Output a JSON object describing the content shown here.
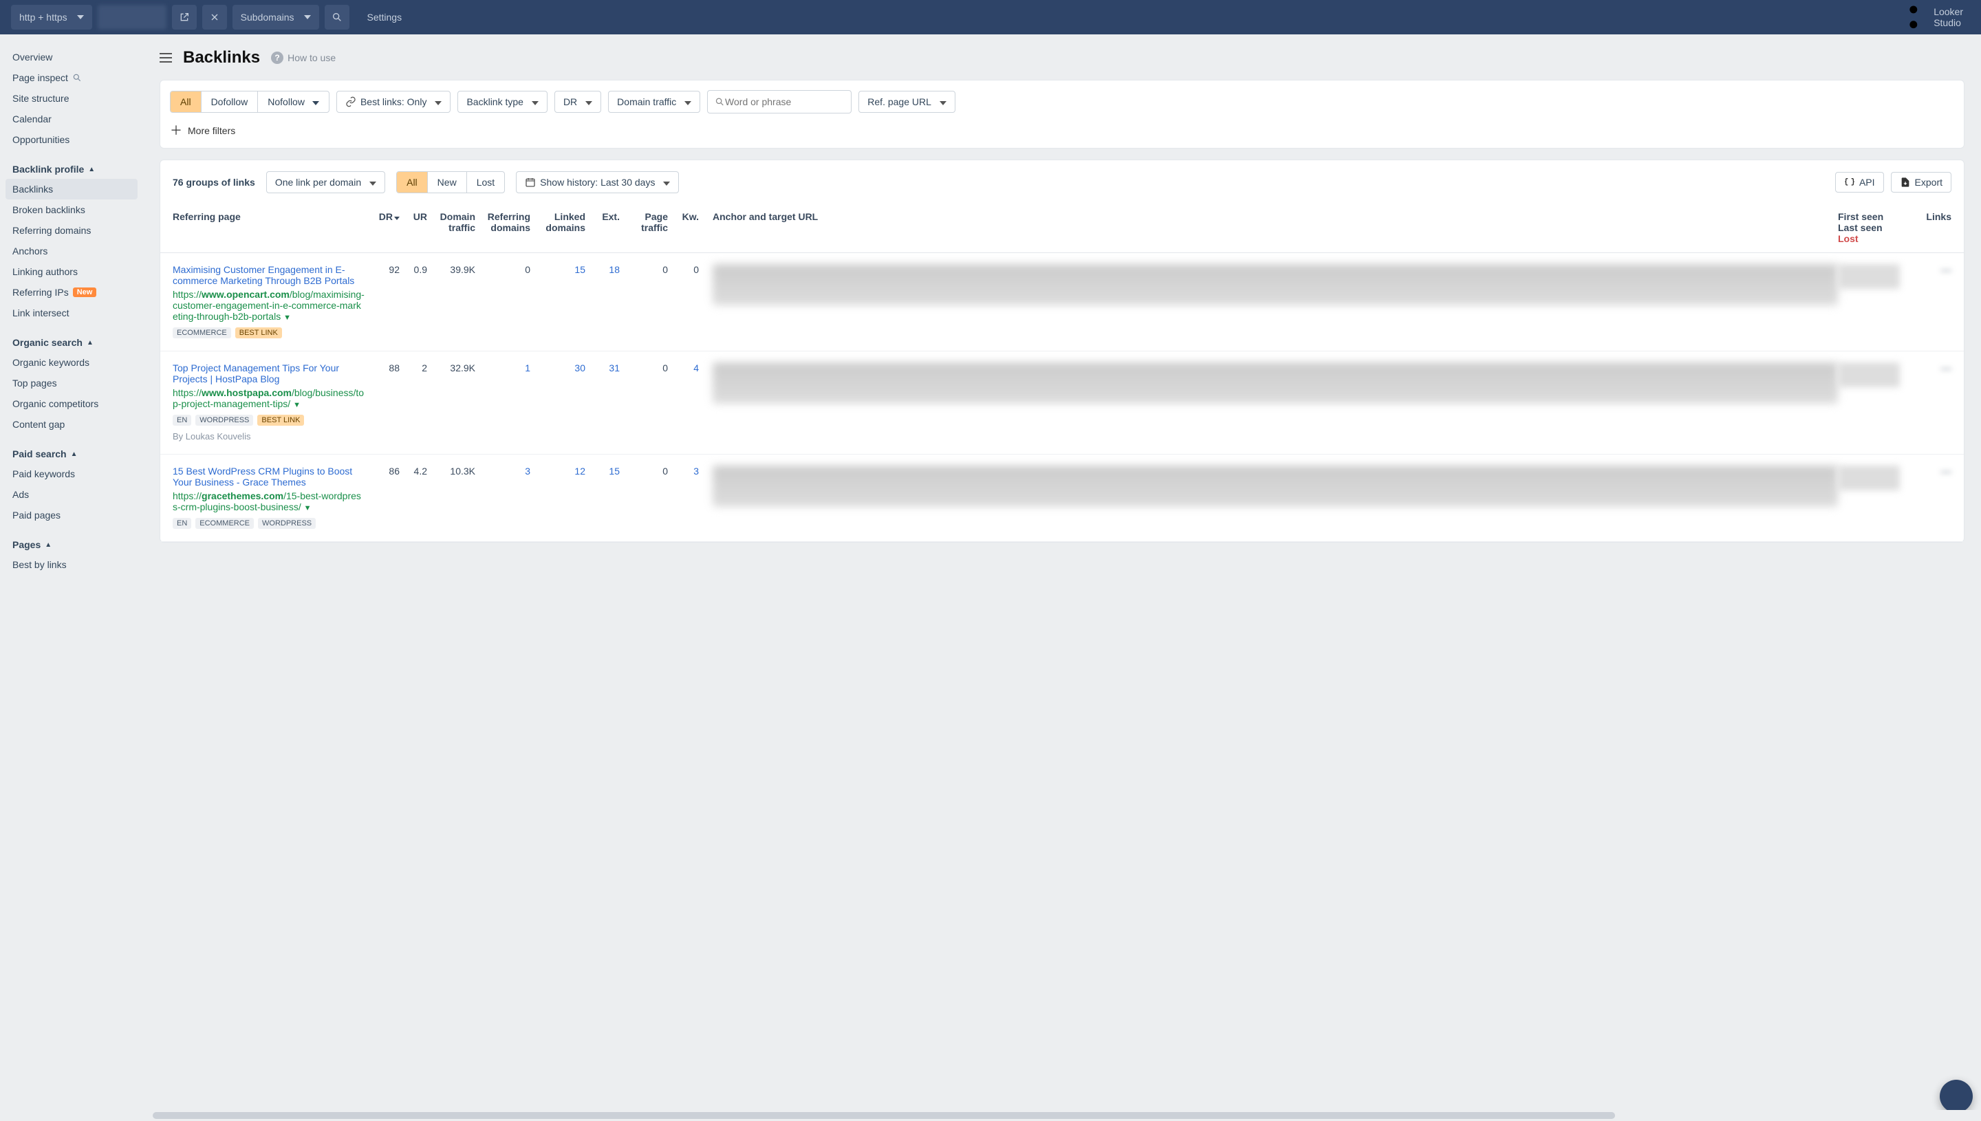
{
  "topbar": {
    "protocol": "http + https",
    "subdomains": "Subdomains",
    "settings": "Settings",
    "looker": "Looker Studio"
  },
  "sidebar": {
    "overview": "Overview",
    "page_inspect": "Page inspect",
    "site_structure": "Site structure",
    "calendar": "Calendar",
    "opportunities": "Opportunities",
    "backlink_profile": "Backlink profile",
    "backlinks": "Backlinks",
    "broken_backlinks": "Broken backlinks",
    "referring_domains": "Referring domains",
    "anchors": "Anchors",
    "linking_authors": "Linking authors",
    "referring_ips": "Referring IPs",
    "new_badge": "New",
    "link_intersect": "Link intersect",
    "organic_search": "Organic search",
    "organic_keywords": "Organic keywords",
    "top_pages": "Top pages",
    "organic_competitors": "Organic competitors",
    "content_gap": "Content gap",
    "paid_search": "Paid search",
    "paid_keywords": "Paid keywords",
    "ads": "Ads",
    "paid_pages": "Paid pages",
    "pages": "Pages",
    "best_by_links": "Best by links"
  },
  "head": {
    "title": "Backlinks",
    "how_to": "How to use"
  },
  "filters": {
    "all": "All",
    "dofollow": "Dofollow",
    "nofollow": "Nofollow",
    "best_links": "Best links: Only",
    "backlink_type": "Backlink type",
    "dr": "DR",
    "domain_traffic": "Domain traffic",
    "search_placeholder": "Word or phrase",
    "ref_page": "Ref. page URL",
    "more": "More filters"
  },
  "toolbar2": {
    "count": "76 groups of links",
    "one_per": "One link per domain",
    "all": "All",
    "new": "New",
    "lost": "Lost",
    "history": "Show history: Last 30 days",
    "api": "API",
    "export": "Export"
  },
  "headers": {
    "referring": "Referring page",
    "dr": "DR",
    "ur": "UR",
    "dt": "Domain traffic",
    "rd": "Referring domains",
    "ld": "Linked domains",
    "ext": "Ext.",
    "pt": "Page traffic",
    "kw": "Kw.",
    "anchor": "Anchor and target URL",
    "first": "First seen",
    "last": "Last seen",
    "lost": "Lost",
    "links": "Links"
  },
  "rows": [
    {
      "title": "Maximising Customer Engagement in E-commerce Marketing Through B2B Portals",
      "url_pre": "https://",
      "url_bold": "www.opencart.com",
      "url_rest": "/blog/maximising-customer-engagement-in-e-commerce-marketing-through-b2b-portals",
      "tags": [
        "ECOMMERCE"
      ],
      "best": true,
      "author": "",
      "dr": "92",
      "ur": "0.9",
      "dt": "39.9K",
      "rd": "0",
      "ld": "15",
      "ext": "18",
      "pt": "0",
      "kw": "0"
    },
    {
      "title": "Top Project Management Tips For Your Projects | HostPapa Blog",
      "url_pre": "https://",
      "url_bold": "www.hostpapa.com",
      "url_rest": "/blog/business/top-project-management-tips/",
      "tags": [
        "EN",
        "WORDPRESS"
      ],
      "best": true,
      "author": "By Loukas Kouvelis",
      "dr": "88",
      "ur": "2",
      "dt": "32.9K",
      "rd": "1",
      "ld": "30",
      "ext": "31",
      "pt": "0",
      "kw": "4"
    },
    {
      "title": "15 Best WordPress CRM Plugins to Boost Your Business - Grace Themes",
      "url_pre": "https://",
      "url_bold": "gracethemes.com",
      "url_rest": "/15-best-wordpress-crm-plugins-boost-business/",
      "tags": [
        "EN",
        "ECOMMERCE",
        "WORDPRESS"
      ],
      "best": false,
      "author": "",
      "dr": "86",
      "ur": "4.2",
      "dt": "10.3K",
      "rd": "3",
      "ld": "12",
      "ext": "15",
      "pt": "0",
      "kw": "3"
    }
  ]
}
